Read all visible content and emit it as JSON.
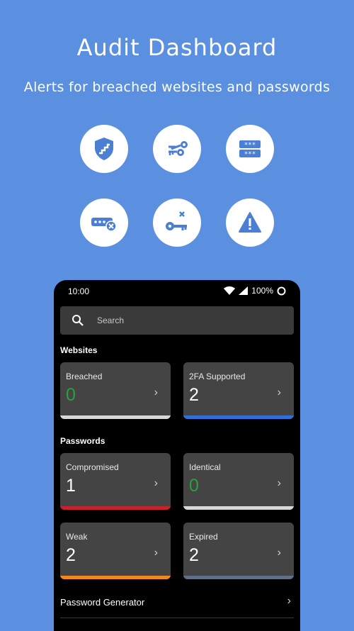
{
  "hero": {
    "title": "Audit Dashboard",
    "subtitle": "Alerts for breached websites and passwords"
  },
  "feature_icons": [
    {
      "icon": "shield-icon"
    },
    {
      "icon": "key-share-icon"
    },
    {
      "icon": "password-field-icon"
    },
    {
      "icon": "password-error-icon"
    },
    {
      "icon": "key-x-icon"
    },
    {
      "icon": "warning-icon"
    }
  ],
  "phone": {
    "status": {
      "time": "10:00",
      "battery": "100%"
    },
    "search": {
      "placeholder": "Search"
    },
    "websites": {
      "label": "Websites",
      "cards": [
        {
          "label": "Breached",
          "value": "0",
          "value_color": "#2e9e3e",
          "bar_color": "#d8d8d8"
        },
        {
          "label": "2FA Supported",
          "value": "2",
          "value_color": "#ffffff",
          "bar_color": "#2f6fd6"
        }
      ]
    },
    "passwords": {
      "label": "Passwords",
      "cards": [
        {
          "label": "Compromised",
          "value": "1",
          "value_color": "#ffffff",
          "bar_color": "#c8222a"
        },
        {
          "label": "Identical",
          "value": "0",
          "value_color": "#2e9e3e",
          "bar_color": "#d8d8d8"
        },
        {
          "label": "Weak",
          "value": "2",
          "value_color": "#ffffff",
          "bar_color": "#f08a1c"
        },
        {
          "label": "Expired",
          "value": "2",
          "value_color": "#ffffff",
          "bar_color": "#5f6f85"
        }
      ]
    },
    "generator": {
      "label": "Password Generator"
    }
  },
  "colors": {
    "background": "#5b8fe0",
    "icon_fill": "#4a7fd4"
  }
}
